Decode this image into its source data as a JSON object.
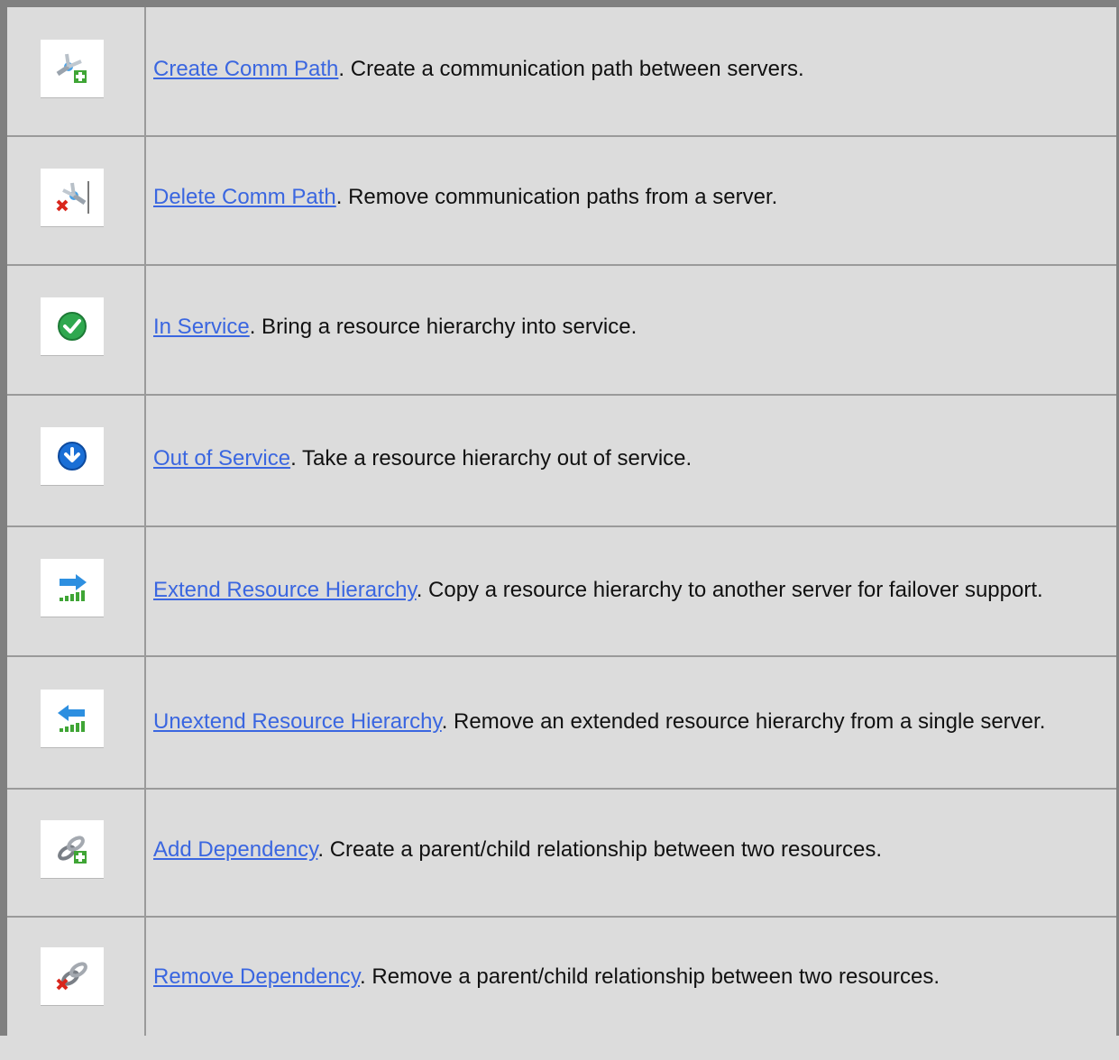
{
  "rows": [
    {
      "link": "Create Comm Path",
      "text": ". Create a communication path between servers.",
      "icon": "create-comm-path-icon"
    },
    {
      "link": "Delete Comm Path",
      "text": ". Remove communication paths from a server.",
      "icon": "delete-comm-path-icon"
    },
    {
      "link": "In Service",
      "text": ". Bring a resource hierarchy into service.",
      "icon": "in-service-icon"
    },
    {
      "link": "Out of Service",
      "text": ". Take a resource hierarchy out of service.",
      "icon": "out-of-service-icon"
    },
    {
      "link": "Extend Resource Hierarchy",
      "text": ". Copy a resource hierarchy to another server for failover support.",
      "icon": "extend-hierarchy-icon"
    },
    {
      "link": "Unextend Resource Hierarchy",
      "text": ". Remove an extended resource hierarchy from a single server.",
      "icon": "unextend-hierarchy-icon"
    },
    {
      "link": "Add Dependency",
      "text": ". Create a parent/child relationship between two resources.",
      "icon": "add-dependency-icon"
    },
    {
      "link": "Remove Dependency",
      "text": ". Remove a parent/child relationship between two resources.",
      "icon": "remove-dependency-icon"
    }
  ],
  "colors": {
    "link": "#3a66e0",
    "background": "#dcdcdc",
    "border": "#808080"
  }
}
